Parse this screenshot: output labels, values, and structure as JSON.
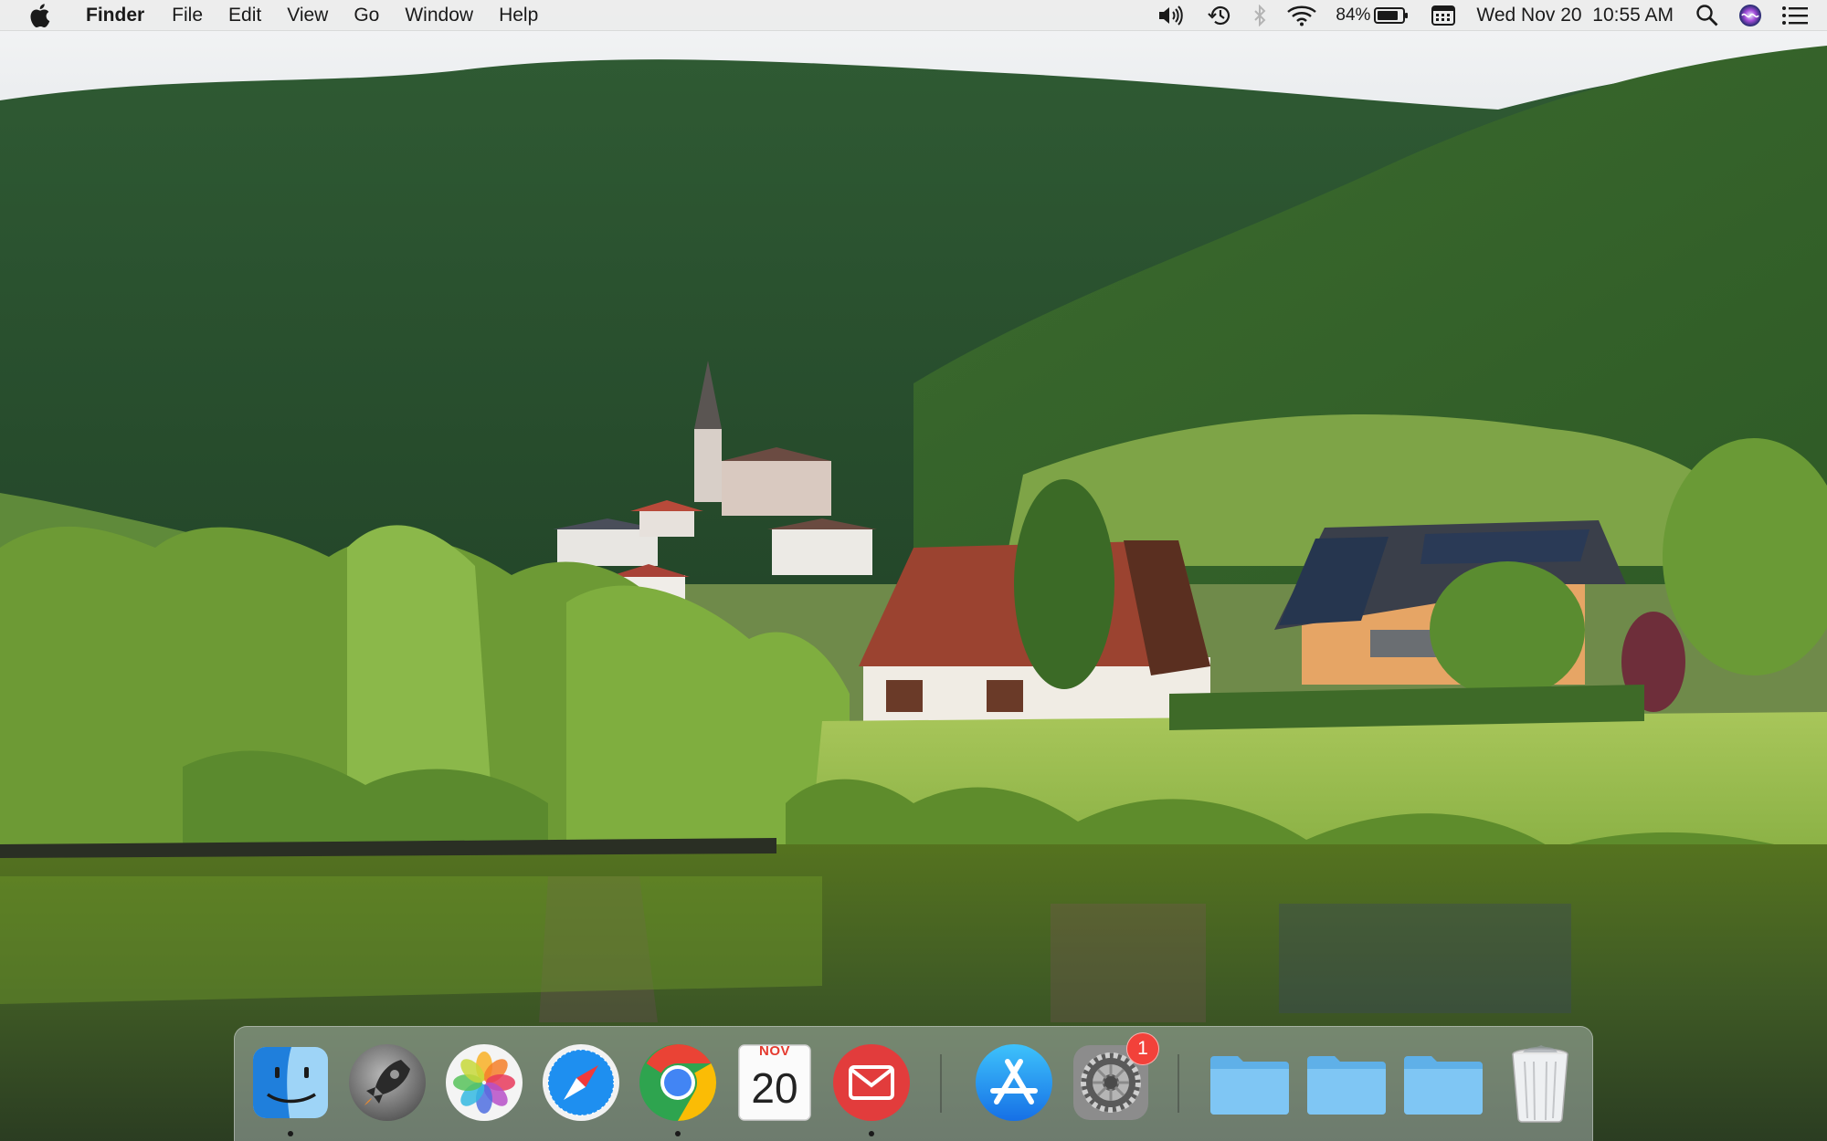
{
  "menubar": {
    "apple_icon": "apple-icon",
    "app_name": "Finder",
    "menus": [
      "File",
      "Edit",
      "View",
      "Go",
      "Window",
      "Help"
    ],
    "status": {
      "volume_icon": "speaker-icon",
      "time_machine_icon": "time-machine-icon",
      "bluetooth_icon": "bluetooth-icon",
      "wifi_icon": "wifi-icon",
      "battery_percent": "84%",
      "battery_icon": "battery-icon",
      "input_icon": "keyboard-viewer-icon",
      "datetime": "Wed Nov 20  10:55 AM",
      "spotlight_icon": "search-icon",
      "siri_icon": "siri-icon",
      "notification_icon": "notification-center-icon"
    }
  },
  "wallpaper": {
    "description_icon": "landscape-wallpaper"
  },
  "dock": {
    "apps": [
      {
        "name": "Finder",
        "icon": "finder-icon",
        "running": true
      },
      {
        "name": "Launchpad",
        "icon": "launchpad-icon",
        "running": false
      },
      {
        "name": "Photos",
        "icon": "photos-icon",
        "running": false
      },
      {
        "name": "Safari",
        "icon": "safari-icon",
        "running": false
      },
      {
        "name": "Google Chrome",
        "icon": "chrome-icon",
        "running": true
      },
      {
        "name": "Calendar",
        "icon": "calendar-icon",
        "running": false,
        "month": "NOV",
        "day": "20"
      },
      {
        "name": "Mail",
        "icon": "mail-icon",
        "running": true
      },
      {
        "name": "App Store",
        "icon": "app-store-icon",
        "running": false
      },
      {
        "name": "System Preferences",
        "icon": "gear-icon",
        "running": false,
        "badge": "1"
      }
    ],
    "folders": [
      {
        "icon": "folder-icon"
      },
      {
        "icon": "folder-icon"
      },
      {
        "icon": "folder-icon"
      }
    ],
    "trash": {
      "icon": "trash-icon"
    }
  }
}
